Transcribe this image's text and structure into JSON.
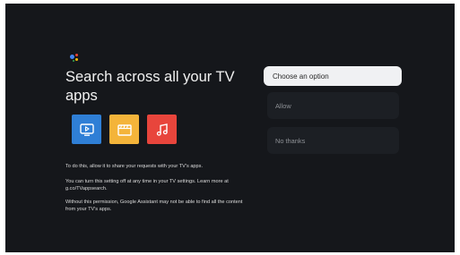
{
  "title": "Search across all your TV apps",
  "apps": [
    {
      "icon": "tv-play-icon",
      "color": "#2f7fd6"
    },
    {
      "icon": "clapperboard-icon",
      "color": "#f4b43a"
    },
    {
      "icon": "music-note-icon",
      "color": "#e8453c"
    }
  ],
  "paragraphs": {
    "p1": "To do this, allow it to share your requests with your TV's apps.",
    "p2": "You can turn this setting off at any time in your TV settings. Learn more at g.co/TVappsearch.",
    "p3": "Without this permission, Google Assistant may not be able to find all the content from your TV's apps."
  },
  "options": {
    "header": "Choose an option",
    "allow": "Allow",
    "no_thanks": "No thanks"
  },
  "colors": {
    "background": "#15171b",
    "option_bg": "#1c1f24",
    "header_bg": "#f0f1f3"
  }
}
